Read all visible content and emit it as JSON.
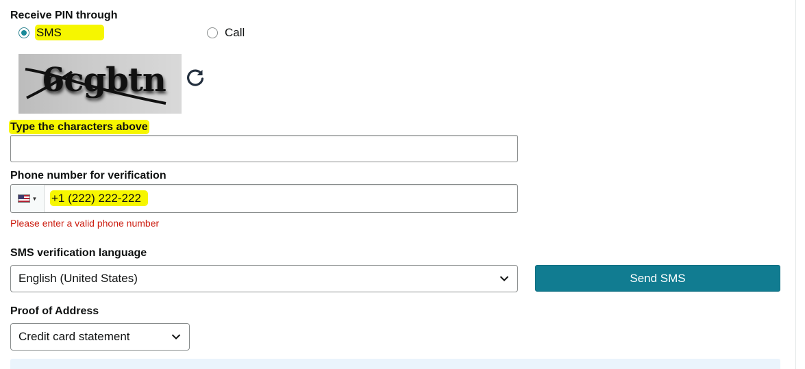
{
  "pin": {
    "label": "Receive PIN through",
    "options": [
      {
        "label": "SMS",
        "selected": true
      },
      {
        "label": "Call",
        "selected": false
      }
    ]
  },
  "captcha": {
    "text": "6cgbtn",
    "refresh_icon": "refresh-icon"
  },
  "characters": {
    "label": "Type the characters above",
    "value": ""
  },
  "phone": {
    "label": "Phone number for verification",
    "country_icon": "us-flag-icon",
    "value": "+1 (222) 222-222",
    "error": "Please enter a valid phone number"
  },
  "sms_language": {
    "label": "SMS verification language",
    "selected": "English (United States)"
  },
  "send_button": {
    "label": "Send SMS"
  },
  "proof": {
    "label": "Proof of Address",
    "selected": "Credit card statement"
  },
  "colors": {
    "highlight": "#f6f600",
    "accent": "#117c91",
    "error": "#cc1c0f"
  }
}
